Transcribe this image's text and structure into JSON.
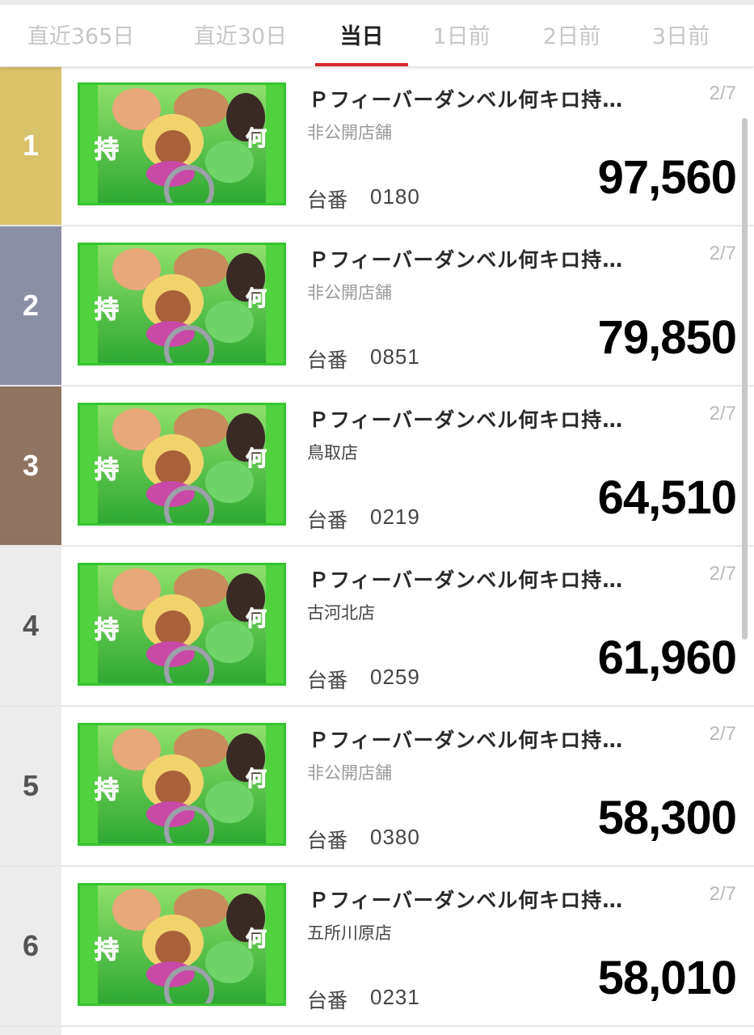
{
  "tabs": [
    {
      "label": "直近365日",
      "active": false
    },
    {
      "label": "直近30日",
      "active": false
    },
    {
      "label": "当日",
      "active": true
    },
    {
      "label": "1日前",
      "active": false
    },
    {
      "label": "2日前",
      "active": false
    },
    {
      "label": "3日前",
      "active": false
    }
  ],
  "colors": {
    "accent": "#d9262b",
    "rank1": "#d8c26a",
    "rank2": "#8a8fa4",
    "rank3": "#8e7461",
    "rank_other": "#ececec",
    "thumb_frame": "#36c431"
  },
  "rows": [
    {
      "rank": "1",
      "title": "Ｐフィーバーダンベル何キロ持…",
      "date": "2/7",
      "store": "非公開店舗",
      "machine_label": "台番",
      "machine_no": "0180",
      "value": "97,560"
    },
    {
      "rank": "2",
      "title": "Ｐフィーバーダンベル何キロ持…",
      "date": "2/7",
      "store": "非公開店舗",
      "machine_label": "台番",
      "machine_no": "0851",
      "value": "79,850"
    },
    {
      "rank": "3",
      "title": "Ｐフィーバーダンベル何キロ持…",
      "date": "2/7",
      "store": "鳥取店",
      "machine_label": "台番",
      "machine_no": "0219",
      "value": "64,510"
    },
    {
      "rank": "4",
      "title": "Ｐフィーバーダンベル何キロ持…",
      "date": "2/7",
      "store": "古河北店",
      "machine_label": "台番",
      "machine_no": "0259",
      "value": "61,960"
    },
    {
      "rank": "5",
      "title": "Ｐフィーバーダンベル何キロ持…",
      "date": "2/7",
      "store": "非公開店舗",
      "machine_label": "台番",
      "machine_no": "0380",
      "value": "58,300"
    },
    {
      "rank": "6",
      "title": "Ｐフィーバーダンベル何キロ持…",
      "date": "2/7",
      "store": "五所川原店",
      "machine_label": "台番",
      "machine_no": "0231",
      "value": "58,010"
    }
  ]
}
